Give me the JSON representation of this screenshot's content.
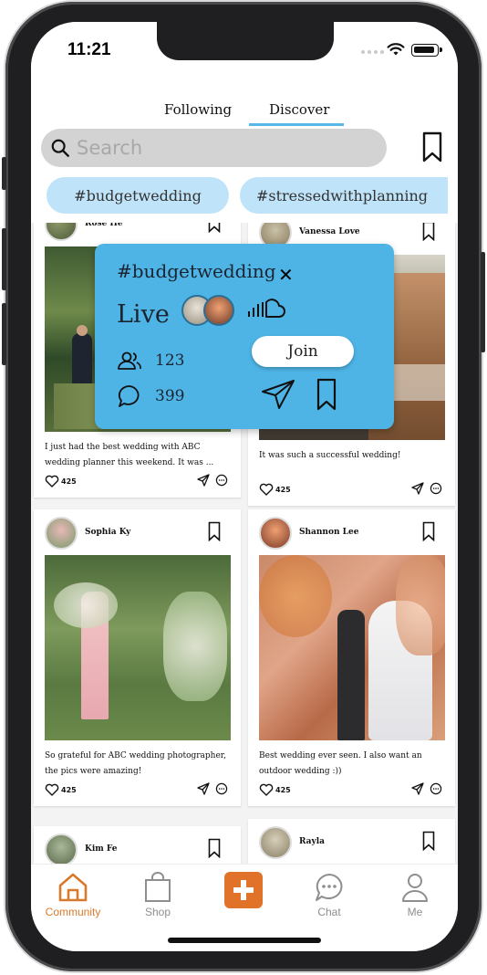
{
  "status_bar": {
    "time": "11:21"
  },
  "header": {
    "tabs": [
      {
        "label": "Following",
        "active": false
      },
      {
        "label": "Discover",
        "active": true
      }
    ],
    "search": {
      "placeholder": "Search"
    },
    "hashtags": [
      "#budgetwedding",
      "#stressedwithplanning"
    ]
  },
  "popup": {
    "hashtag": "#budgetwedding",
    "close_icon": "x",
    "live_label": "Live",
    "participants": "123",
    "comments": "399",
    "join_label": "Join"
  },
  "posts": [
    {
      "user": "Rose He",
      "caption": "I just had the best wedding with ABC wedding planner this weekend. It was ...",
      "likes": "425"
    },
    {
      "user": "Vanessa Love",
      "caption": "It was such a successful wedding!",
      "likes": "425"
    },
    {
      "user": "Sophia Ky",
      "caption": "So grateful for ABC wedding photographer, the pics were amazing!",
      "likes": "425"
    },
    {
      "user": "Shannon Lee",
      "caption": "Best wedding ever seen. I also want an outdoor wedding :))",
      "likes": "425"
    },
    {
      "user": "Kim Fe",
      "caption": "",
      "likes": ""
    },
    {
      "user": "Rayla",
      "caption": "",
      "likes": ""
    }
  ],
  "bottom_nav": [
    {
      "label": "Community",
      "icon": "home-icon",
      "active": true
    },
    {
      "label": "Shop",
      "icon": "shopping-bag-icon",
      "active": false
    },
    {
      "label": "",
      "icon": "plus-icon",
      "active": false
    },
    {
      "label": "Chat",
      "icon": "chat-icon",
      "active": false
    },
    {
      "label": "Me",
      "icon": "person-icon",
      "active": false
    }
  ],
  "colors": {
    "accent_blue": "#4eb4e6",
    "chip_blue": "#bfe3f8",
    "accent_orange": "#e0722a"
  }
}
